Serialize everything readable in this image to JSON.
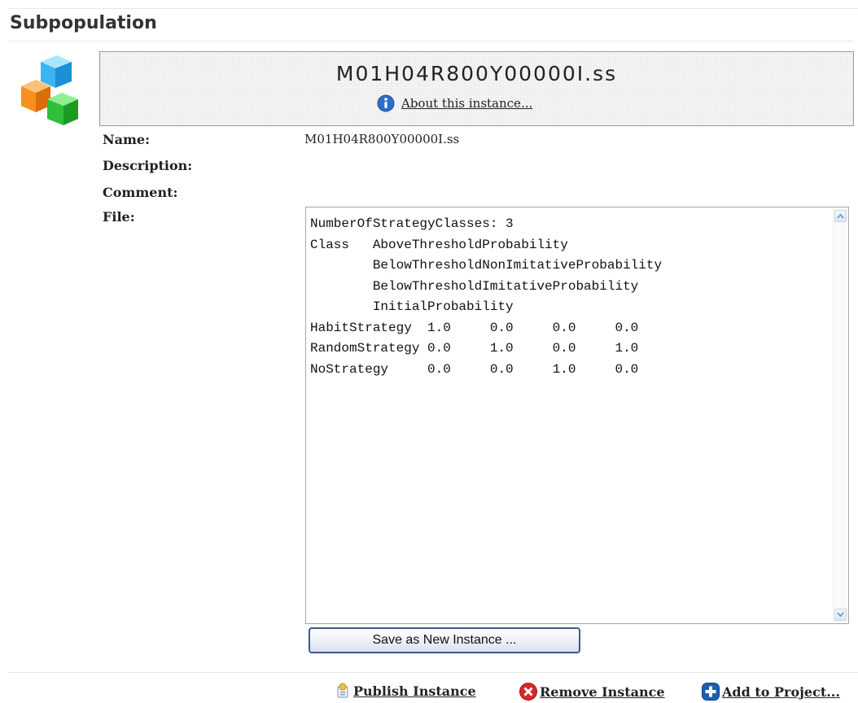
{
  "section": {
    "title": "Subpopulation"
  },
  "instance": {
    "name": "M01H04R800Y00000I.ss",
    "about_link": "About this instance..."
  },
  "fields": {
    "name_label": "Name:",
    "name_value": "M01H04R800Y00000I.ss",
    "description_label": "Description:",
    "description_value": "",
    "comment_label": "Comment:",
    "comment_value": "",
    "file_label": "File:"
  },
  "file": {
    "lines": [
      "NumberOfStrategyClasses: 3",
      "Class   AboveThresholdProbability",
      "        BelowThresholdNonImitativeProbability",
      "        BelowThresholdImitativeProbability",
      "        InitialProbability",
      "HabitStrategy  1.0     0.0     0.0     0.0",
      "RandomStrategy 0.0     1.0     0.0     1.0",
      "NoStrategy     0.0     0.0     1.0     0.0"
    ]
  },
  "buttons": {
    "save_new": "Save as New Instance ..."
  },
  "actions": {
    "publish": "Publish Instance",
    "remove": "Remove Instance",
    "add_project": "Add to Project..."
  },
  "icons": {
    "subpopulation": "cubes-icon",
    "about": "info-icon",
    "publish": "publish-icon",
    "remove": "remove-icon",
    "add": "add-icon"
  },
  "colors": {
    "info_blue": "#2a6fc9",
    "remove_red": "#d62828",
    "add_blue": "#1d5fb6"
  }
}
